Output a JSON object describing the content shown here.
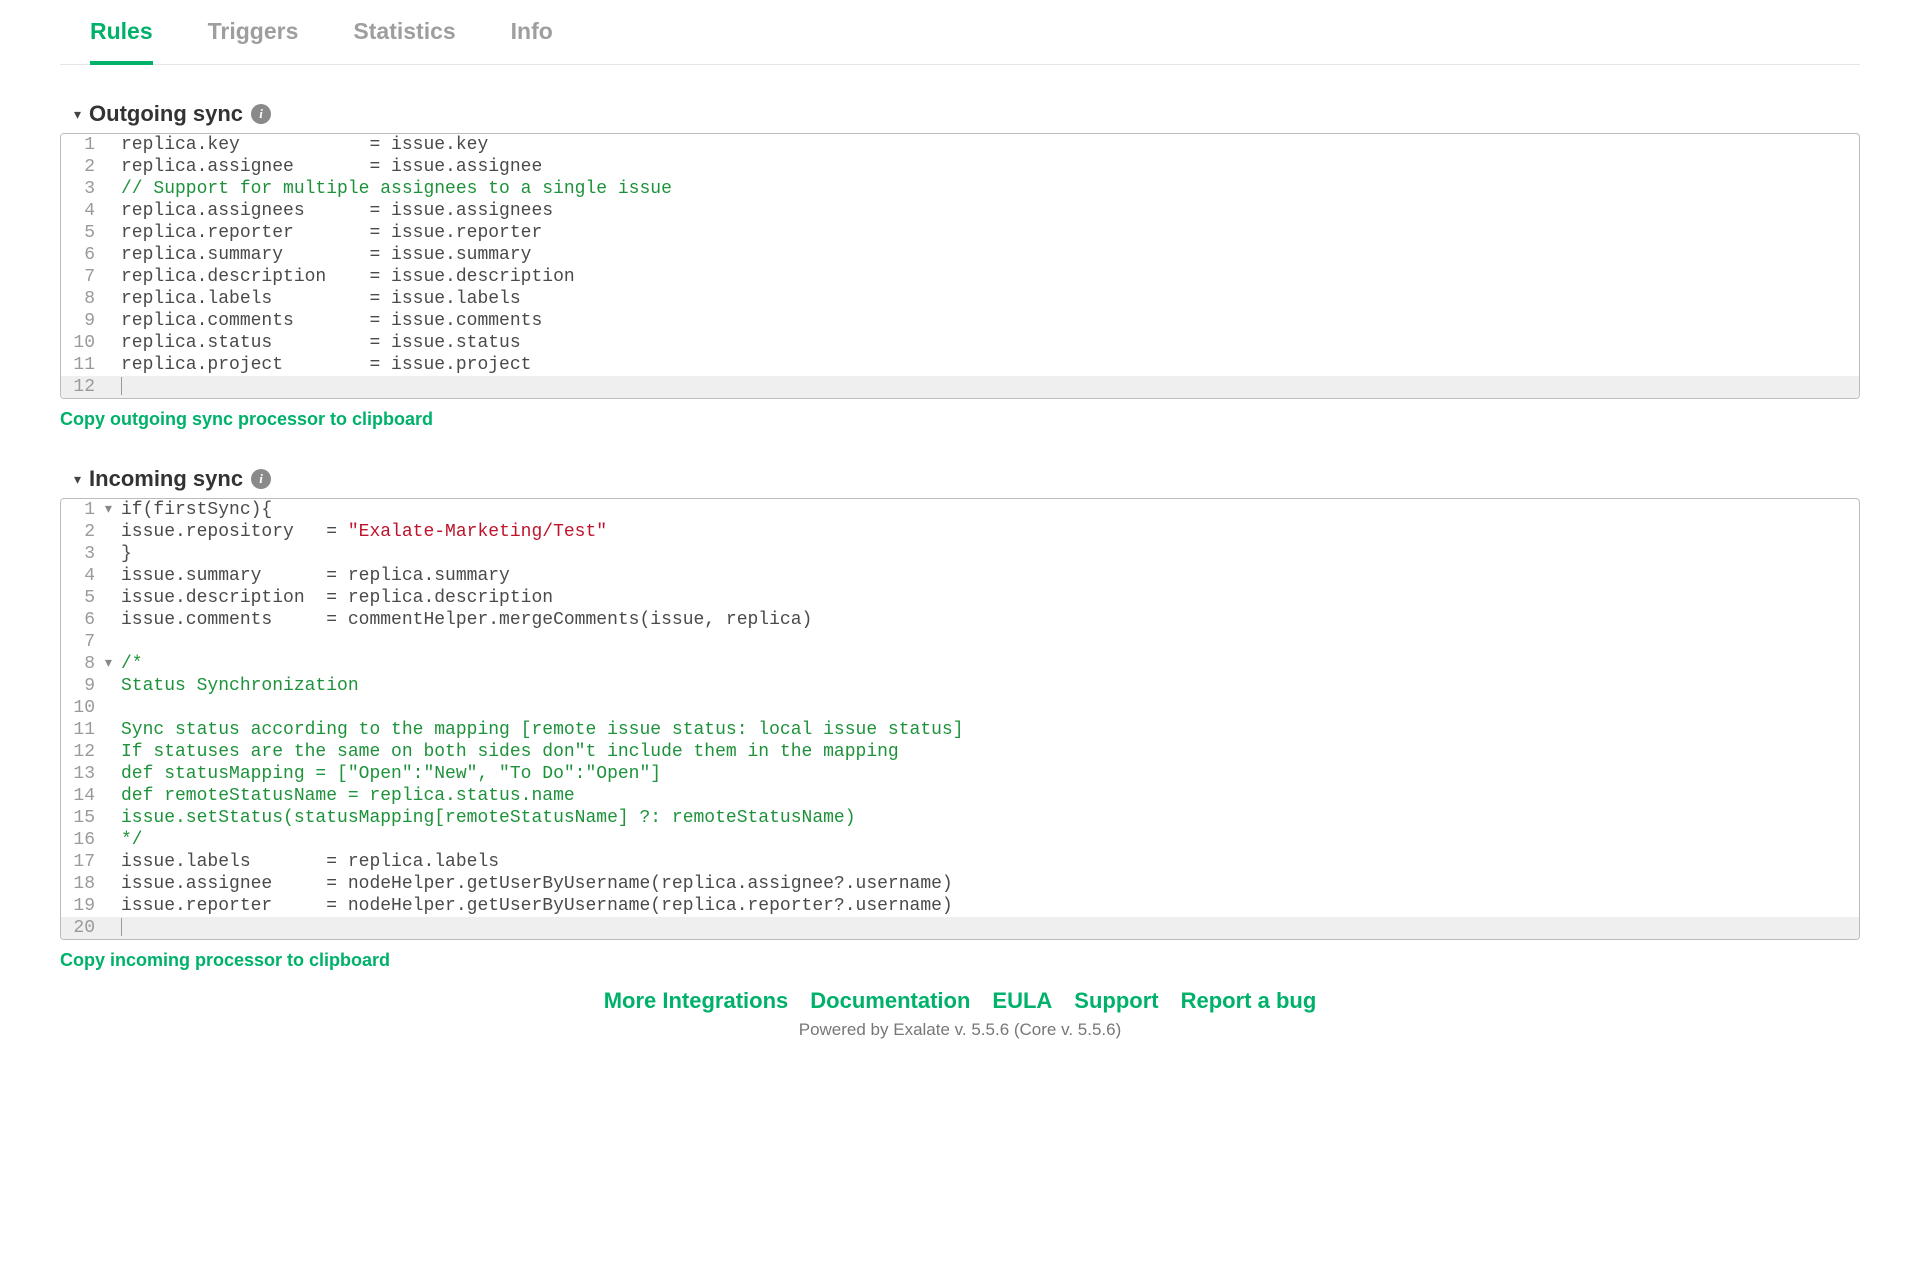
{
  "tabs": [
    "Rules",
    "Triggers",
    "Statistics",
    "Info"
  ],
  "active_tab_index": 0,
  "outgoing": {
    "title": "Outgoing sync",
    "copy_label": "Copy outgoing sync processor to clipboard",
    "lines": [
      {
        "n": 1,
        "fold": "",
        "segs": [
          {
            "t": "replica.key            = issue.key",
            "c": ""
          }
        ]
      },
      {
        "n": 2,
        "fold": "",
        "segs": [
          {
            "t": "replica.assignee       = issue.assignee",
            "c": ""
          }
        ]
      },
      {
        "n": 3,
        "fold": "",
        "segs": [
          {
            "t": "// Support for multiple assignees to a single issue",
            "c": "cm-comment"
          }
        ]
      },
      {
        "n": 4,
        "fold": "",
        "segs": [
          {
            "t": "replica.assignees      = issue.assignees",
            "c": ""
          }
        ]
      },
      {
        "n": 5,
        "fold": "",
        "segs": [
          {
            "t": "replica.reporter       = issue.reporter",
            "c": ""
          }
        ]
      },
      {
        "n": 6,
        "fold": "",
        "segs": [
          {
            "t": "replica.summary        = issue.summary",
            "c": ""
          }
        ]
      },
      {
        "n": 7,
        "fold": "",
        "segs": [
          {
            "t": "replica.description    = issue.description",
            "c": ""
          }
        ]
      },
      {
        "n": 8,
        "fold": "",
        "segs": [
          {
            "t": "replica.labels         = issue.labels",
            "c": ""
          }
        ]
      },
      {
        "n": 9,
        "fold": "",
        "segs": [
          {
            "t": "replica.comments       = issue.comments",
            "c": ""
          }
        ]
      },
      {
        "n": 10,
        "fold": "",
        "segs": [
          {
            "t": "replica.status         = issue.status",
            "c": ""
          }
        ]
      },
      {
        "n": 11,
        "fold": "",
        "segs": [
          {
            "t": "replica.project        = issue.project",
            "c": ""
          }
        ]
      },
      {
        "n": 12,
        "fold": "",
        "segs": [],
        "last_empty": true
      }
    ]
  },
  "incoming": {
    "title": "Incoming sync",
    "copy_label": "Copy incoming processor to clipboard",
    "lines": [
      {
        "n": 1,
        "fold": "▾",
        "segs": [
          {
            "t": "if(firstSync){",
            "c": ""
          }
        ]
      },
      {
        "n": 2,
        "fold": "",
        "segs": [
          {
            "t": "issue.repository   = ",
            "c": ""
          },
          {
            "t": "\"Exalate-Marketing/Test\"",
            "c": "cm-string"
          }
        ]
      },
      {
        "n": 3,
        "fold": "",
        "segs": [
          {
            "t": "}",
            "c": ""
          }
        ]
      },
      {
        "n": 4,
        "fold": "",
        "segs": [
          {
            "t": "issue.summary      = replica.summary",
            "c": ""
          }
        ]
      },
      {
        "n": 5,
        "fold": "",
        "segs": [
          {
            "t": "issue.description  = replica.description",
            "c": ""
          }
        ]
      },
      {
        "n": 6,
        "fold": "",
        "segs": [
          {
            "t": "issue.comments     = commentHelper.mergeComments(issue, replica)",
            "c": ""
          }
        ]
      },
      {
        "n": 7,
        "fold": "",
        "segs": [
          {
            "t": "",
            "c": ""
          }
        ]
      },
      {
        "n": 8,
        "fold": "▾",
        "segs": [
          {
            "t": "/*",
            "c": "cm-comment"
          }
        ]
      },
      {
        "n": 9,
        "fold": "",
        "segs": [
          {
            "t": "Status Synchronization",
            "c": "cm-comment"
          }
        ]
      },
      {
        "n": 10,
        "fold": "",
        "segs": [
          {
            "t": "",
            "c": "cm-comment"
          }
        ]
      },
      {
        "n": 11,
        "fold": "",
        "segs": [
          {
            "t": "Sync status according to the mapping [remote issue status: local issue status]",
            "c": "cm-comment"
          }
        ]
      },
      {
        "n": 12,
        "fold": "",
        "segs": [
          {
            "t": "If statuses are the same on both sides don\"t include them in the mapping",
            "c": "cm-comment"
          }
        ]
      },
      {
        "n": 13,
        "fold": "",
        "segs": [
          {
            "t": "def statusMapping = [\"Open\":\"New\", \"To Do\":\"Open\"]",
            "c": "cm-comment"
          }
        ]
      },
      {
        "n": 14,
        "fold": "",
        "segs": [
          {
            "t": "def remoteStatusName = replica.status.name",
            "c": "cm-comment"
          }
        ]
      },
      {
        "n": 15,
        "fold": "",
        "segs": [
          {
            "t": "issue.setStatus(statusMapping[remoteStatusName] ?: remoteStatusName)",
            "c": "cm-comment"
          }
        ]
      },
      {
        "n": 16,
        "fold": "",
        "segs": [
          {
            "t": "*/",
            "c": "cm-comment"
          }
        ]
      },
      {
        "n": 17,
        "fold": "",
        "segs": [
          {
            "t": "issue.labels       = replica.labels",
            "c": ""
          }
        ]
      },
      {
        "n": 18,
        "fold": "",
        "segs": [
          {
            "t": "issue.assignee     = nodeHelper.getUserByUsername(replica.assignee?.username)",
            "c": ""
          }
        ]
      },
      {
        "n": 19,
        "fold": "",
        "segs": [
          {
            "t": "issue.reporter     = nodeHelper.getUserByUsername(replica.reporter?.username)",
            "c": ""
          }
        ]
      },
      {
        "n": 20,
        "fold": "",
        "segs": [],
        "last_empty": true
      }
    ]
  },
  "footer": {
    "links": [
      "More Integrations",
      "Documentation",
      "EULA",
      "Support",
      "Report a bug"
    ],
    "powered": "Powered by Exalate v. 5.5.6 (Core v. 5.5.6)"
  }
}
